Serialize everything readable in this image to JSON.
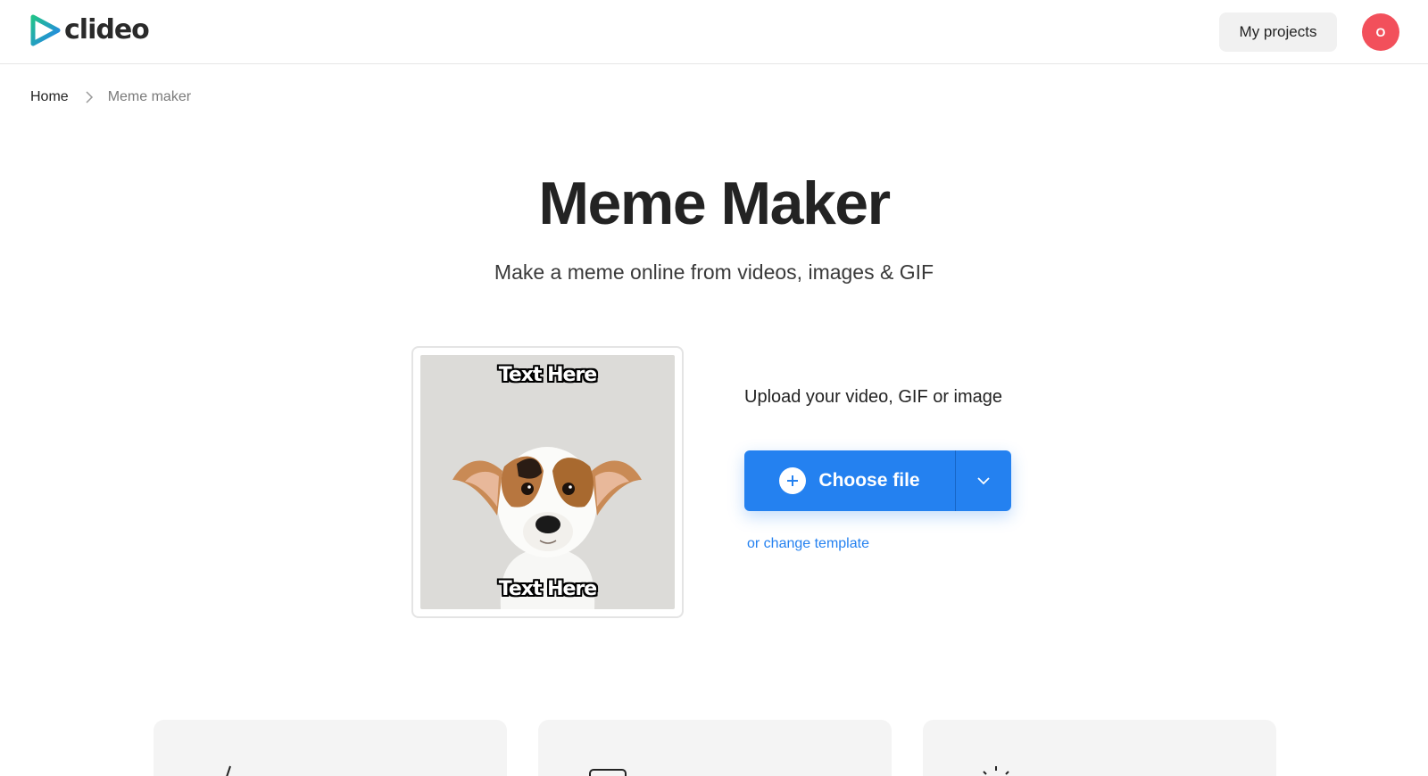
{
  "header": {
    "logo_text": "clideo",
    "my_projects_label": "My projects",
    "avatar_initial": "O"
  },
  "breadcrumb": {
    "home": "Home",
    "current": "Meme maker"
  },
  "hero": {
    "title": "Meme Maker",
    "subtitle": "Make a meme online from videos, images & GIF"
  },
  "preview": {
    "top_text": "Text Here",
    "bottom_text": "Text Here"
  },
  "upload": {
    "label": "Upload your video, GIF or image",
    "choose_file_label": "Choose file",
    "change_template_label": "or change template"
  },
  "feature_cards": [
    {
      "icon": "pen-icon"
    },
    {
      "icon": "monitor-icon"
    },
    {
      "icon": "lightbulb-icon"
    }
  ],
  "colors": {
    "accent": "#2481f0",
    "avatar": "#f2505b",
    "logo_gradient_start": "#24b47e",
    "logo_gradient_end": "#2481f0"
  }
}
